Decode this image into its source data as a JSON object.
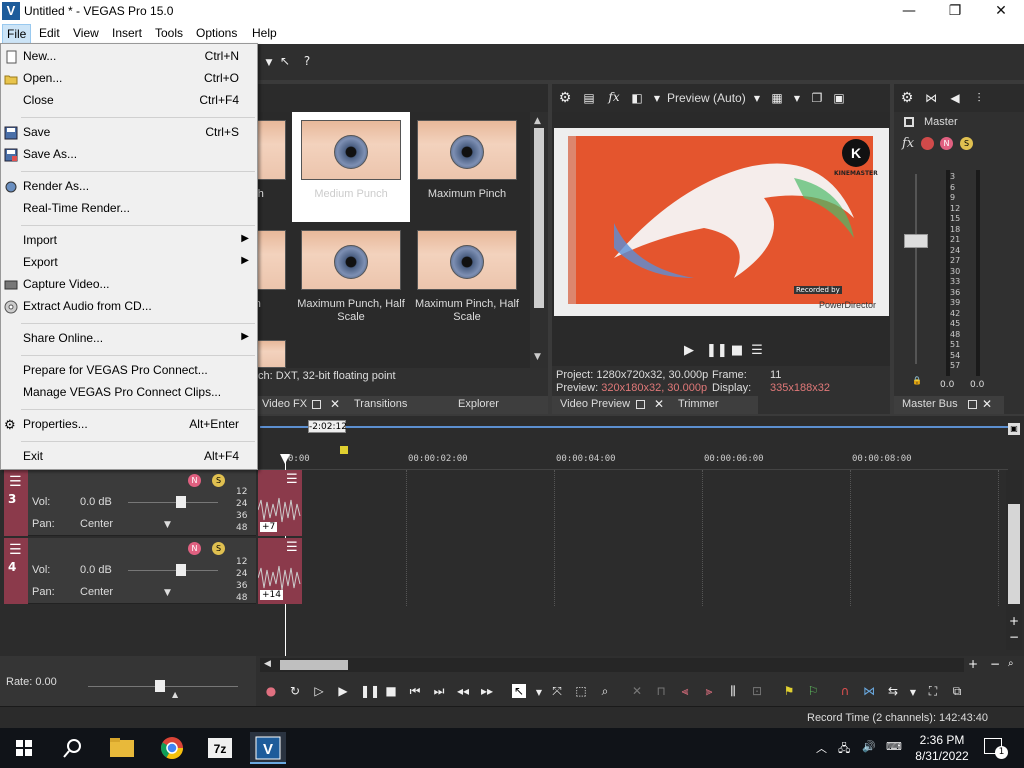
{
  "window": {
    "app_icon_letter": "V",
    "title": "Untitled * - VEGAS Pro 15.0",
    "minimize": "—",
    "restore": "❐",
    "close": "✕"
  },
  "menubar": [
    "File",
    "Edit",
    "View",
    "Insert",
    "Tools",
    "Options",
    "Help"
  ],
  "file_menu": [
    {
      "label": "New...",
      "shortcut": "Ctrl+N",
      "icon": "new-file-icon"
    },
    {
      "label": "Open...",
      "shortcut": "Ctrl+O",
      "icon": "folder-open-icon"
    },
    {
      "label": "Close",
      "shortcut": "Ctrl+F4",
      "icon": ""
    },
    {
      "label": "Save",
      "shortcut": "Ctrl+S",
      "icon": "save-icon"
    },
    {
      "label": "Save As...",
      "shortcut": "",
      "icon": "save-as-icon"
    },
    {
      "label": "Render As...",
      "shortcut": "",
      "icon": "render-icon"
    },
    {
      "label": "Real-Time Render...",
      "shortcut": "",
      "icon": ""
    },
    {
      "label": "Import",
      "shortcut": "",
      "icon": "",
      "submenu": true
    },
    {
      "label": "Export",
      "shortcut": "",
      "icon": "",
      "submenu": true
    },
    {
      "label": "Capture Video...",
      "shortcut": "",
      "icon": "capture-icon"
    },
    {
      "label": "Extract Audio from CD...",
      "shortcut": "",
      "icon": "cd-icon"
    },
    {
      "label": "Share Online...",
      "shortcut": "",
      "icon": "",
      "submenu": true
    },
    {
      "label": "Prepare for VEGAS Pro Connect...",
      "shortcut": "",
      "icon": ""
    },
    {
      "label": "Manage VEGAS Pro Connect Clips...",
      "shortcut": "",
      "icon": ""
    },
    {
      "label": "Properties...",
      "shortcut": "Alt+Enter",
      "icon": "gear-icon"
    },
    {
      "label": "Exit",
      "shortcut": "Alt+F4",
      "icon": ""
    }
  ],
  "fx_panel": {
    "thumbs": [
      {
        "label": "nch"
      },
      {
        "label": "Medium Punch"
      },
      {
        "label": "Maximum Pinch"
      },
      {
        "label": "ch"
      },
      {
        "label": "Maximum Punch, Half Scale"
      },
      {
        "label": "Maximum Pinch, Half Scale"
      }
    ],
    "status": "ch: DXT, 32-bit floating point",
    "tabs": [
      "Video FX",
      "Transitions",
      "Explorer"
    ]
  },
  "preview": {
    "mode": "Preview (Auto)",
    "overlay_brand": "KINEMASTER",
    "overlay_recorded": "Recorded by",
    "overlay_power": "PowerDirector",
    "project_label": "Project:",
    "project_value": "1280x720x32, 30.000p",
    "frame_label": "Frame:",
    "frame_value": "11",
    "preview_label": "Preview:",
    "preview_value": "320x180x32, 30.000p",
    "display_label": "Display:",
    "display_value": "335x188x32",
    "tabs": [
      "Video Preview",
      "Trimmer"
    ]
  },
  "master": {
    "label": "Master",
    "scale": [
      "3",
      "6",
      "9",
      "12",
      "15",
      "18",
      "21",
      "24",
      "27",
      "30",
      "33",
      "36",
      "39",
      "42",
      "45",
      "48",
      "51",
      "54",
      "57"
    ],
    "value_left": "0.0",
    "value_right": "0.0",
    "tab": "Master Bus"
  },
  "timeline": {
    "cursor_time": "-2:02:12",
    "ruler_start": "0:00",
    "ruler": [
      "00:00:02:00",
      "00:00:04:00",
      "00:00:06:00",
      "00:00:08:00"
    ],
    "tracks": [
      {
        "num": "3",
        "vol_label": "Vol:",
        "vol": "0.0 dB",
        "pan_label": "Pan:",
        "pan": "Center",
        "meter": [
          "12",
          "24",
          "36",
          "48"
        ],
        "badge": "+7"
      },
      {
        "num": "4",
        "vol_label": "Vol:",
        "vol": "0.0 dB",
        "pan_label": "Pan:",
        "pan": "Center",
        "meter": [
          "12",
          "24",
          "36",
          "48"
        ],
        "badge": "+14"
      }
    ],
    "rate": "Rate: 0.00"
  },
  "statusbar": {
    "record_time": "Record Time (2 channels): 142:43:40"
  },
  "taskbar": {
    "time": "2:36 PM",
    "date": "8/31/2022",
    "notifications": "1"
  }
}
